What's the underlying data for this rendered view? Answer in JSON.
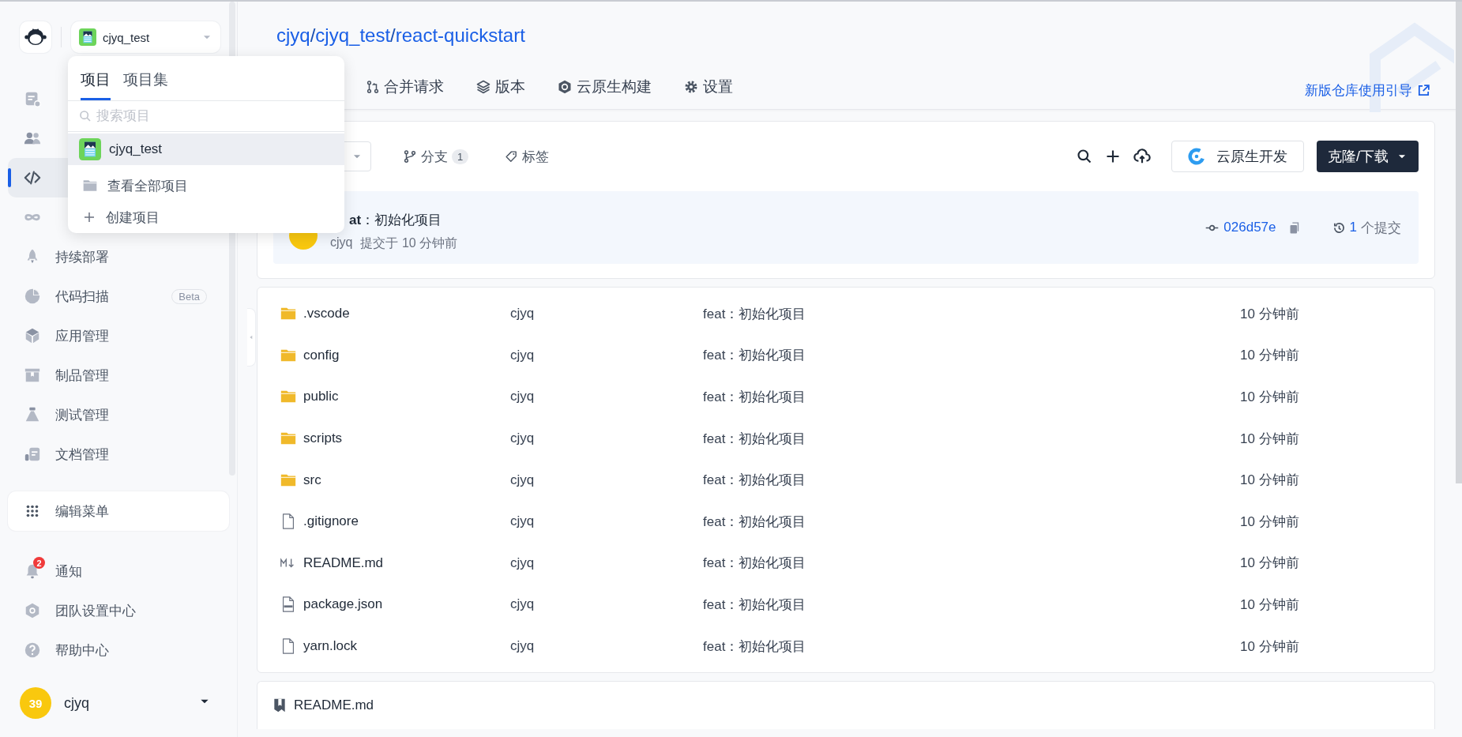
{
  "sidebar": {
    "project_selector": {
      "name": "cjyq_test"
    },
    "items": [
      {
        "selected": false
      },
      {
        "selected": false
      },
      {
        "selected": true
      },
      {
        "selected": false
      },
      {
        "label": "持续部署",
        "selected": false
      },
      {
        "label": "代码扫描",
        "badge": "Beta",
        "selected": false
      },
      {
        "label": "应用管理",
        "selected": false
      },
      {
        "label": "制品管理",
        "selected": false
      },
      {
        "label": "测试管理",
        "selected": false
      },
      {
        "label": "文档管理",
        "selected": false
      }
    ],
    "edit_menu": "编辑菜单",
    "bottom_items": [
      {
        "label": "通知",
        "badge": "2"
      },
      {
        "label": "团队设置中心"
      },
      {
        "label": "帮助中心"
      }
    ],
    "user": {
      "avatar": "39",
      "name": "cjyq"
    }
  },
  "project_popup": {
    "tabs": [
      {
        "label": "项目",
        "selected": true
      },
      {
        "label": "项目集",
        "selected": false
      }
    ],
    "search": {
      "placeholder": "搜索项目"
    },
    "projects": [
      {
        "name": "cjyq_test",
        "selected": true
      }
    ],
    "actions": [
      {
        "label": "查看全部项目"
      },
      {
        "label": "创建项目"
      }
    ]
  },
  "repo": {
    "breadcrumb": [
      {
        "text": "cjyq",
        "kind": "link"
      },
      {
        "text": "/",
        "kind": "sep"
      },
      {
        "text": "cjyq_test",
        "kind": "link"
      },
      {
        "text": "/",
        "kind": "sep"
      },
      {
        "text": "react-quickstart",
        "kind": "link"
      }
    ],
    "tabs": [
      {
        "label": "合并请求",
        "selected": false
      },
      {
        "label": "版本",
        "selected": false
      },
      {
        "label": "云原生构建",
        "selected": false
      },
      {
        "label": "设置",
        "selected": false
      }
    ],
    "guide_link": "新版仓库使用引导"
  },
  "toolbar": {
    "branches": {
      "label": "分支",
      "count": "1"
    },
    "tags": "标签",
    "cloud_dev": "云原生开发",
    "clone": "克隆/下载"
  },
  "commit": {
    "message": "**at**：初始化项目",
    "author": "cjyq",
    "time": "提交于 10 分钟前",
    "hash": "026d57e",
    "count": "1",
    "count_label": "个提交"
  },
  "files": [
    {
      "kind": "folder",
      "name": ".vscode",
      "author": "cjyq",
      "message": "feat：初始化项目",
      "time": "10 分钟前"
    },
    {
      "kind": "folder",
      "name": "config",
      "author": "cjyq",
      "message": "feat：初始化项目",
      "time": "10 分钟前"
    },
    {
      "kind": "folder",
      "name": "public",
      "author": "cjyq",
      "message": "feat：初始化项目",
      "time": "10 分钟前"
    },
    {
      "kind": "folder",
      "name": "scripts",
      "author": "cjyq",
      "message": "feat：初始化项目",
      "time": "10 分钟前"
    },
    {
      "kind": "folder",
      "name": "src",
      "author": "cjyq",
      "message": "feat：初始化项目",
      "time": "10 分钟前"
    },
    {
      "kind": "file",
      "name": ".gitignore",
      "author": "cjyq",
      "message": "feat：初始化项目",
      "time": "10 分钟前"
    },
    {
      "kind": "markdown",
      "name": "README.md",
      "author": "cjyq",
      "message": "feat：初始化项目",
      "time": "10 分钟前"
    },
    {
      "kind": "json",
      "name": "package.json",
      "author": "cjyq",
      "message": "feat：初始化项目",
      "time": "10 分钟前"
    },
    {
      "kind": "file",
      "name": "yarn.lock",
      "author": "cjyq",
      "message": "feat：初始化项目",
      "time": "10 分钟前"
    }
  ],
  "readme": {
    "title": "README.md"
  }
}
